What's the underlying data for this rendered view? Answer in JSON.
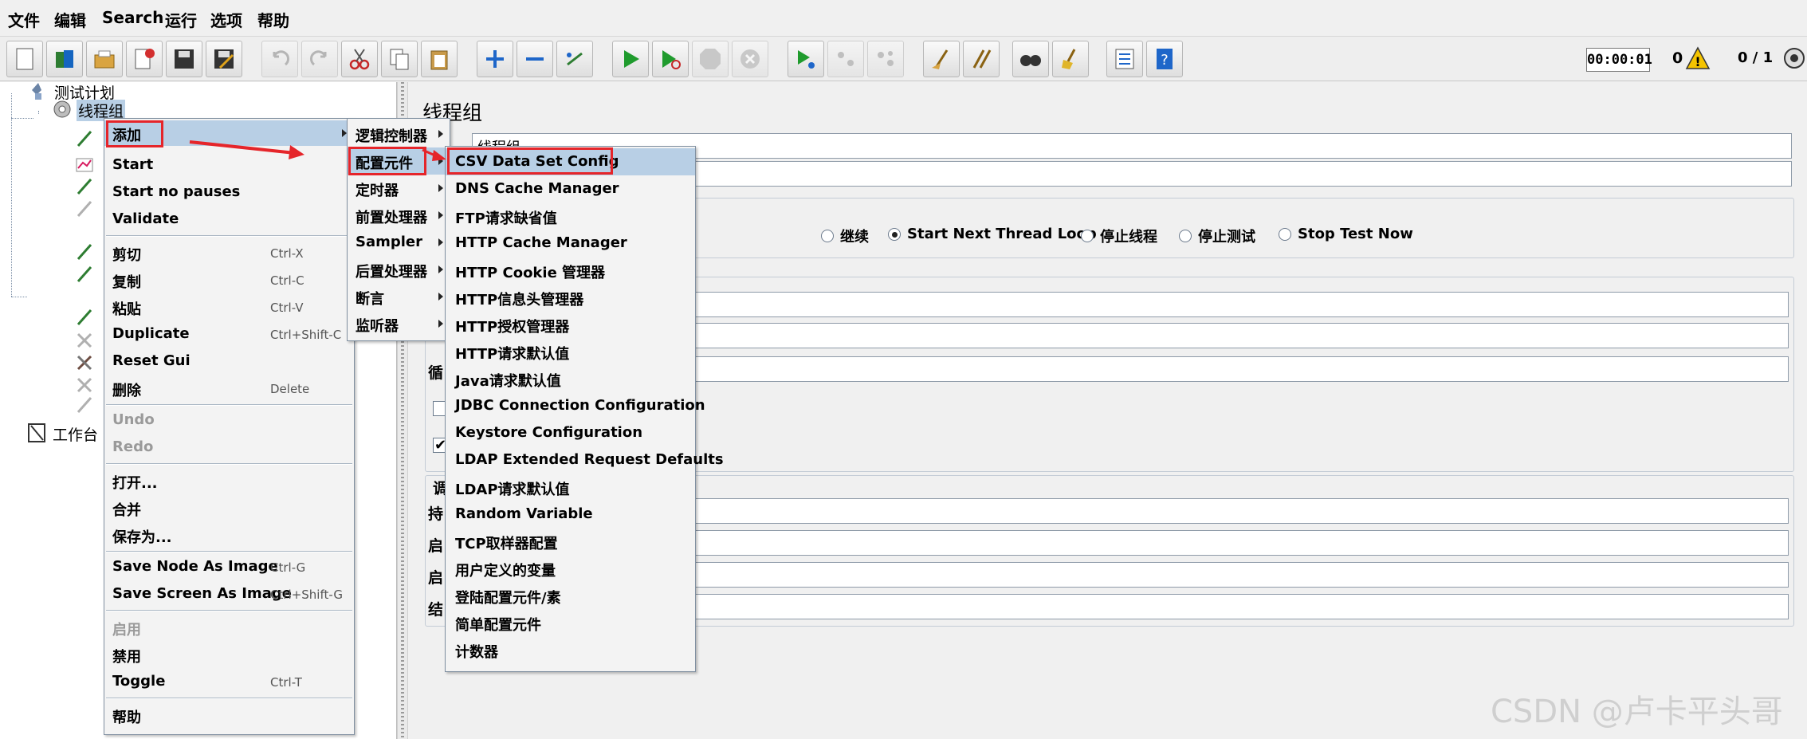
{
  "menubar": {
    "items": [
      "文件",
      "编辑",
      "Search",
      "运行",
      "选项",
      "帮助"
    ]
  },
  "toolbar": {
    "timer": "00:00:01",
    "warnings": "0",
    "threads": "0 / 1"
  },
  "tree": {
    "test_plan": "测试计划",
    "thread_group": "线程组",
    "workbench": "工作台"
  },
  "context_menu": {
    "items": [
      {
        "label": "添加",
        "shortcut": ""
      },
      {
        "label": "Start",
        "shortcut": ""
      },
      {
        "label": "Start no pauses",
        "shortcut": ""
      },
      {
        "label": "Validate",
        "shortcut": ""
      },
      {
        "label": "剪切",
        "shortcut": "Ctrl-X"
      },
      {
        "label": "复制",
        "shortcut": "Ctrl-C"
      },
      {
        "label": "粘贴",
        "shortcut": "Ctrl-V"
      },
      {
        "label": "Duplicate",
        "shortcut": "Ctrl+Shift-C"
      },
      {
        "label": "Reset Gui",
        "shortcut": ""
      },
      {
        "label": "删除",
        "shortcut": "Delete"
      },
      {
        "label": "Undo",
        "shortcut": ""
      },
      {
        "label": "Redo",
        "shortcut": ""
      },
      {
        "label": "打开...",
        "shortcut": ""
      },
      {
        "label": "合并",
        "shortcut": ""
      },
      {
        "label": "保存为...",
        "shortcut": ""
      },
      {
        "label": "Save Node As Image",
        "shortcut": "Ctrl-G"
      },
      {
        "label": "Save Screen As Image",
        "shortcut": "Ctrl+Shift-G"
      },
      {
        "label": "启用",
        "shortcut": ""
      },
      {
        "label": "禁用",
        "shortcut": ""
      },
      {
        "label": "Toggle",
        "shortcut": "Ctrl-T"
      },
      {
        "label": "帮助",
        "shortcut": ""
      }
    ]
  },
  "add_submenu": {
    "items": [
      "逻辑控制器",
      "配置元件",
      "定时器",
      "前置处理器",
      "Sampler",
      "后置处理器",
      "断言",
      "监听器"
    ]
  },
  "config_submenu": {
    "items": [
      "CSV Data Set Config",
      "DNS Cache Manager",
      "FTP请求缺省值",
      "HTTP Cache Manager",
      "HTTP Cookie 管理器",
      "HTTP信息头管理器",
      "HTTP授权管理器",
      "HTTP请求默认值",
      "Java请求默认值",
      "JDBC Connection Configuration",
      "Keystore Configuration",
      "LDAP Extended Request Defaults",
      "LDAP请求默认值",
      "Random Variable",
      "TCP取样器配置",
      "用户定义的变量",
      "登陆配置元件/素",
      "简单配置元件",
      "计数器"
    ]
  },
  "right_panel": {
    "title": "线程组",
    "name_value": "线程组",
    "radio_options": [
      {
        "label": "继续",
        "selected": false
      },
      {
        "label": "Start Next Thread Loop",
        "selected": true
      },
      {
        "label": "停止线程",
        "selected": false
      },
      {
        "label": "停止测试",
        "selected": false
      },
      {
        "label": "Stop Test Now",
        "selected": false
      }
    ],
    "loop_label_fragment": "循",
    "scheduler_label_fragment": "调",
    "duration_fragment": "持",
    "start_delay_fragment": "启",
    "start_time_fragment": "启",
    "end_time_fragment": "结"
  },
  "watermark": "CSDN @卢卡平头哥"
}
